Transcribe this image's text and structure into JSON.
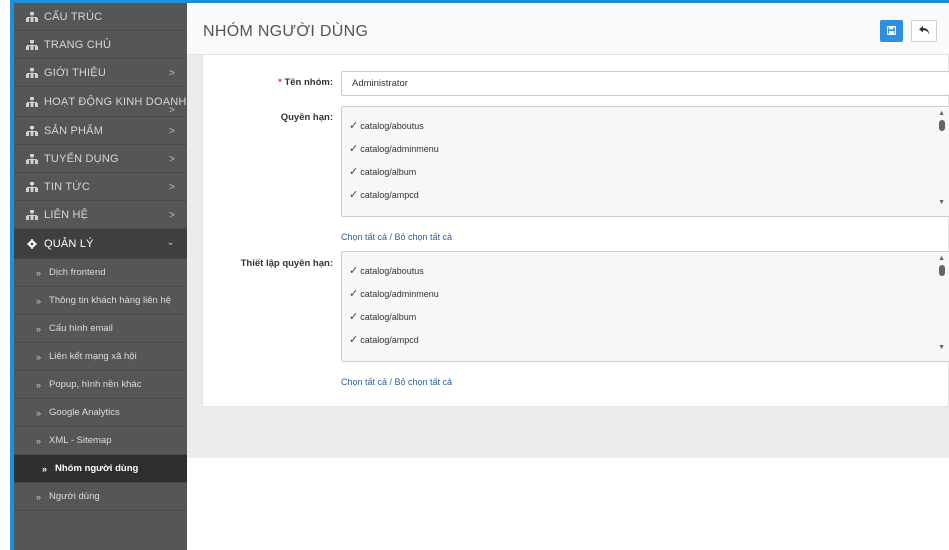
{
  "sidebar": {
    "items": [
      {
        "label": "CẤU TRÚC",
        "chevron": ""
      },
      {
        "label": "TRANG CHỦ",
        "chevron": ""
      },
      {
        "label": "GIỚI THIỆU",
        "chevron": ">"
      },
      {
        "label": "HOẠT ĐỘNG KINH DOANH",
        "chevron": ">"
      },
      {
        "label": "SẢN PHẨM",
        "chevron": ">"
      },
      {
        "label": "TUYỂN DỤNG",
        "chevron": ">"
      },
      {
        "label": "TIN TỨC",
        "chevron": ">"
      },
      {
        "label": "LIÊN HỆ",
        "chevron": ">"
      }
    ],
    "open_item": {
      "label": "QUẢN LÝ",
      "chevron": "⌄",
      "icon": "gear-icon"
    },
    "item_icon": "sitemap-icon",
    "sub_items": [
      {
        "label": "Dịch frontend"
      },
      {
        "label": "Thông tin khách hàng liên hệ"
      },
      {
        "label": "Cấu hình email"
      },
      {
        "label": "Liên kết mạng xã hội"
      },
      {
        "label": "Popup, hình nền khác"
      },
      {
        "label": "Google Analytics"
      },
      {
        "label": "XML - Sitemap"
      },
      {
        "label": "Nhóm người dùng"
      },
      {
        "label": "Người dùng"
      }
    ],
    "active_sub_item": "Nhóm người dùng",
    "sub_marker": "»"
  },
  "header": {
    "title": "NHÓM NGƯỜI DÙNG",
    "save_icon": "save-icon",
    "back_icon": "back-arrow-icon"
  },
  "form": {
    "group_name_required": "*",
    "group_name_label": "Tên nhóm:",
    "group_name_value": "Administrator",
    "permissions_label": "Quyền hạn:",
    "permissions": [
      "catalog/aboutus",
      "catalog/adminmenu",
      "catalog/album",
      "catalog/ampcd"
    ],
    "permissions_select_all": "Chọn tất cả / Bỏ chọn tất cả",
    "settings_label": "Thiết lập quyền hạn:",
    "settings": [
      "catalog/aboutus",
      "catalog/adminmenu",
      "catalog/album",
      "catalog/ampcd"
    ],
    "settings_select_all": "Chọn tất cả / Bỏ chọn tất cả",
    "check_mark": "✓"
  },
  "colors": {
    "accent": "#1e8fd8",
    "sidebar_bg": "#565656",
    "active_bg": "#2f2f2f",
    "link": "#2a5f98"
  }
}
